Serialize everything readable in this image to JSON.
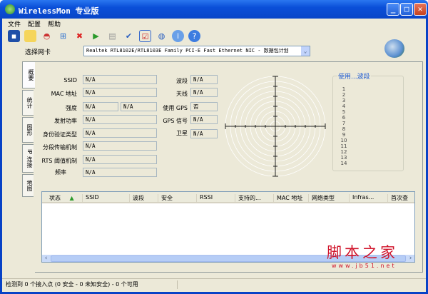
{
  "title": "WirelessMon 专业版",
  "menu": [
    "文件",
    "配置",
    "帮助"
  ],
  "toolbar": {
    "icons": [
      "save-icon",
      "open-folder-icon",
      "gauge-icon",
      "network-connect-icon",
      "network-disconnect-icon",
      "play-log-icon",
      "stop-log-icon",
      "check-icon",
      "checklist-icon",
      "globe-icon",
      "info-icon",
      "help-icon"
    ]
  },
  "nic": {
    "label": "选择网卡",
    "value": "Realtek RTL8102E/RTL8103E Family PCI-E Fast Ethernet NIC - 数据包计划"
  },
  "tabs": [
    "概要",
    "统计",
    "图形",
    "IP 连接",
    "地图"
  ],
  "fields": {
    "ssid": {
      "label": "SSID",
      "value": "N/A"
    },
    "mac": {
      "label": "MAC 地址",
      "value": "N/A"
    },
    "strength": {
      "label": "强度",
      "value": "N/A",
      "value2": "N/A"
    },
    "tx_power": {
      "label": "发射功率",
      "value": "N/A"
    },
    "auth": {
      "label": "身份验证类型",
      "value": "N/A"
    },
    "frag": {
      "label": "分段传输机制",
      "value": "N/A"
    },
    "rts": {
      "label": "RTS 阈值机制",
      "value": "N/A"
    },
    "freq": {
      "label": "频率",
      "value": "N/A"
    },
    "band": {
      "label": "波段",
      "value": "N/A"
    },
    "antenna": {
      "label": "天线",
      "value": "N/A"
    },
    "use_gps": {
      "label": "使用 GPS",
      "value": "否"
    },
    "gps_signal": {
      "label": "GPS 信号",
      "value": "N/A"
    },
    "satellite": {
      "label": "卫星",
      "value": "N/A"
    }
  },
  "channel_group": {
    "title": "使用...波段",
    "channels": [
      "1",
      "2",
      "3",
      "4",
      "5",
      "6",
      "7",
      "8",
      "9",
      "10",
      "11",
      "12",
      "13",
      "14"
    ]
  },
  "table": {
    "columns": [
      "状态",
      "SSID",
      "波段",
      "安全",
      "RSSI",
      "支持的...",
      "MAC 地址",
      "网络类型",
      "Infras...",
      "首次查"
    ]
  },
  "status": "检测到 0 个接入点 (0 安全 - 0 未知安全) - 0 个可用",
  "watermark": {
    "text": "脚本之家",
    "url": "www.jb51.net"
  }
}
